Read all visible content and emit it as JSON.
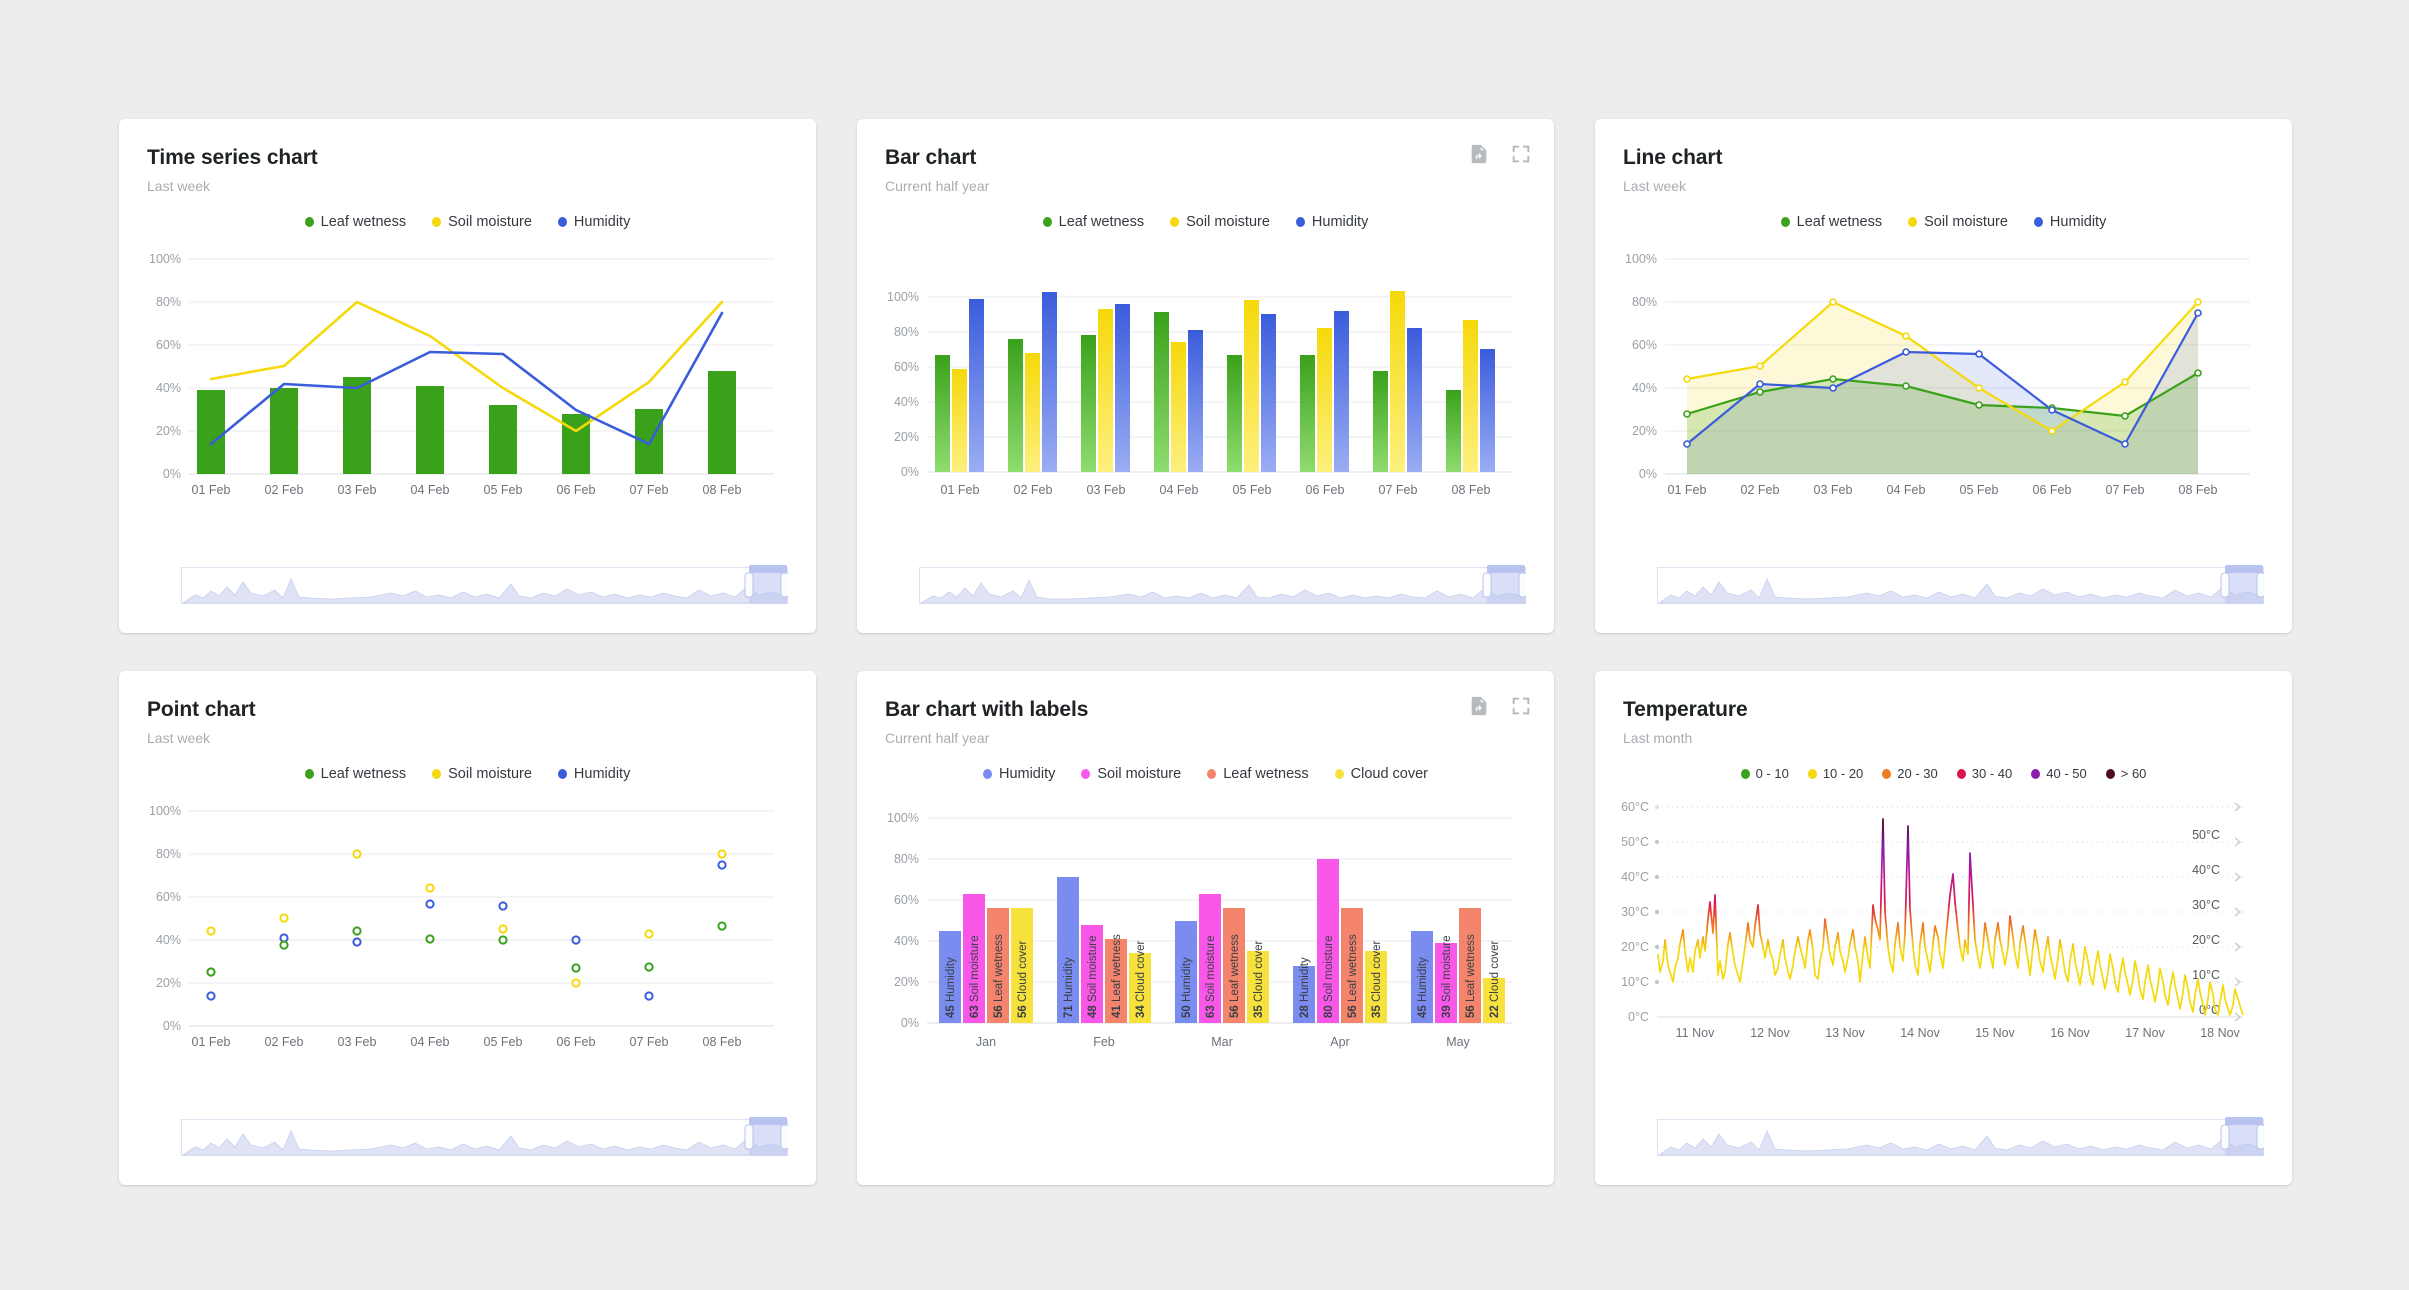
{
  "theme": {
    "page_bg": "#ebedef",
    "card_bg": "#ffffff",
    "colors": {
      "leaf_wetness": "#3aa11b",
      "soil_moisture": "#f5d90a",
      "humidity": "#3b5cdb",
      "cloud_cover": "#f7e13c",
      "soil_moisture_pink": "#f857e8",
      "leaf_wetness_salmon": "#f4846b",
      "humidity_periwinkle": "#7a8cf0"
    }
  },
  "cards": [
    {
      "id": "time-series-chart",
      "title": "Time series chart",
      "subtitle": "Last week",
      "tools": [],
      "legend": [
        {
          "label": "Leaf wetness",
          "color": "#3aa11b"
        },
        {
          "label": "Soil moisture",
          "color": "#f5d90a"
        },
        {
          "label": "Humidity",
          "color": "#3b5cdb"
        }
      ]
    },
    {
      "id": "bar-chart",
      "title": "Bar chart",
      "subtitle": "Current half year",
      "tools": [
        "export-icon",
        "fullscreen-icon"
      ],
      "legend": [
        {
          "label": "Leaf wetness",
          "color": "#3aa11b"
        },
        {
          "label": "Soil moisture",
          "color": "#f5d90a"
        },
        {
          "label": "Humidity",
          "color": "#3b5cdb"
        }
      ]
    },
    {
      "id": "line-chart",
      "title": "Line chart",
      "subtitle": "Last week",
      "tools": [],
      "legend": [
        {
          "label": "Leaf wetness",
          "color": "#3aa11b"
        },
        {
          "label": "Soil moisture",
          "color": "#f5d90a"
        },
        {
          "label": "Humidity",
          "color": "#3b5cdb"
        }
      ]
    },
    {
      "id": "point-chart",
      "title": "Point chart",
      "subtitle": "Last week",
      "tools": [],
      "legend": [
        {
          "label": "Leaf wetness",
          "color": "#3aa11b"
        },
        {
          "label": "Soil moisture",
          "color": "#f5d90a"
        },
        {
          "label": "Humidity",
          "color": "#3b5cdb"
        }
      ]
    },
    {
      "id": "bar-chart-with-labels",
      "title": "Bar chart with labels",
      "subtitle": "Current half year",
      "tools": [
        "export-icon",
        "fullscreen-icon"
      ],
      "legend": [
        {
          "label": "Humidity",
          "color": "#7a8cf0"
        },
        {
          "label": "Soil moisture",
          "color": "#f857e8"
        },
        {
          "label": "Leaf wetness",
          "color": "#f4846b"
        },
        {
          "label": "Cloud cover",
          "color": "#f7e13c"
        }
      ]
    },
    {
      "id": "temperature-chart",
      "title": "Temperature",
      "subtitle": "Last month",
      "tools": [],
      "legend": [
        {
          "label": "0 - 10",
          "color": "#3aa11b"
        },
        {
          "label": "10 - 20",
          "color": "#f5d90a"
        },
        {
          "label": "20 - 30",
          "color": "#f07c1e"
        },
        {
          "label": "30 - 40",
          "color": "#d9154a"
        },
        {
          "label": "40 - 50",
          "color": "#8c1cb0"
        },
        {
          "label": "> 60",
          "color": "#4d0b1e"
        }
      ]
    }
  ],
  "chart_data": [
    {
      "id": "time-series-chart",
      "type": "bar+line",
      "title": "Time series chart",
      "subtitle": "Last week",
      "categories": [
        "01 Feb",
        "02 Feb",
        "03 Feb",
        "04 Feb",
        "05 Feb",
        "06 Feb",
        "07 Feb",
        "08 Feb"
      ],
      "ylabel": "",
      "ytick_labels": [
        "0%",
        "20%",
        "40%",
        "60%",
        "80%",
        "100%"
      ],
      "ylim": [
        0,
        100
      ],
      "grid": true,
      "legend_position": "top-center",
      "series": [
        {
          "name": "Leaf wetness",
          "render": "bar",
          "color": "#3aa11b",
          "values": [
            39,
            40,
            45,
            41,
            32,
            28,
            30,
            48
          ]
        },
        {
          "name": "Soil moisture",
          "render": "line",
          "color": "#f5d90a",
          "values": [
            44,
            50,
            81,
            65,
            40,
            20,
            43,
            81
          ]
        },
        {
          "name": "Humidity",
          "render": "line",
          "color": "#3b5cdb",
          "values": [
            14,
            42,
            40,
            57,
            56,
            30,
            14,
            75
          ]
        }
      ]
    },
    {
      "id": "bar-chart",
      "type": "bar",
      "title": "Bar chart",
      "subtitle": "Current half year",
      "categories": [
        "01 Feb",
        "02 Feb",
        "03 Feb",
        "04 Feb",
        "05 Feb",
        "06 Feb",
        "07 Feb",
        "08 Feb"
      ],
      "ytick_labels": [
        "0%",
        "20%",
        "40%",
        "60%",
        "80%",
        "100%"
      ],
      "ylim": [
        0,
        110
      ],
      "grid": true,
      "legend_position": "top-center",
      "series": [
        {
          "name": "Leaf wetness",
          "color": "#3aa11b",
          "values": [
            67,
            76,
            78,
            91,
            67,
            67,
            58,
            47
          ]
        },
        {
          "name": "Soil moisture",
          "color": "#f5d90a",
          "values": [
            59,
            68,
            93,
            74,
            98,
            82,
            103,
            87
          ]
        },
        {
          "name": "Humidity",
          "color": "#3b5cdb",
          "values": [
            99,
            103,
            96,
            81,
            90,
            92,
            82,
            70
          ]
        }
      ]
    },
    {
      "id": "line-chart",
      "type": "area",
      "title": "Line chart",
      "subtitle": "Last week",
      "categories": [
        "01 Feb",
        "02 Feb",
        "03 Feb",
        "04 Feb",
        "05 Feb",
        "06 Feb",
        "07 Feb",
        "08 Feb"
      ],
      "ytick_labels": [
        "0%",
        "20%",
        "40%",
        "60%",
        "80%",
        "100%"
      ],
      "ylim": [
        0,
        100
      ],
      "grid": true,
      "legend_position": "top-center",
      "series": [
        {
          "name": "Leaf wetness",
          "color": "#3aa11b",
          "values": [
            28,
            38,
            44,
            41,
            32,
            31,
            27,
            47
          ]
        },
        {
          "name": "Soil moisture",
          "color": "#f5d90a",
          "values": [
            44,
            50,
            81,
            65,
            40,
            20,
            43,
            81
          ]
        },
        {
          "name": "Humidity",
          "color": "#3b5cdb",
          "values": [
            14,
            42,
            40,
            57,
            56,
            30,
            14,
            75
          ]
        }
      ]
    },
    {
      "id": "point-chart",
      "type": "scatter",
      "title": "Point chart",
      "subtitle": "Last week",
      "categories": [
        "01 Feb",
        "02 Feb",
        "03 Feb",
        "04 Feb",
        "05 Feb",
        "06 Feb",
        "07 Feb",
        "08 Feb"
      ],
      "ytick_labels": [
        "0%",
        "20%",
        "40%",
        "60%",
        "80%",
        "100%"
      ],
      "ylim": [
        0,
        100
      ],
      "grid": true,
      "legend_position": "top-center",
      "series": [
        {
          "name": "Leaf wetness",
          "color": "#3aa11b",
          "values": [
            25,
            42,
            45,
            41,
            44,
            33,
            27,
            47
          ]
        },
        {
          "name": "Soil moisture",
          "color": "#f5d90a",
          "values": [
            44,
            50,
            81,
            65,
            45,
            20,
            43,
            81
          ]
        },
        {
          "name": "Humidity",
          "color": "#3b5cdb",
          "values": [
            14,
            42,
            39,
            57,
            56,
            40,
            14,
            75
          ]
        }
      ]
    },
    {
      "id": "bar-chart-with-labels",
      "type": "bar",
      "title": "Bar chart with labels",
      "subtitle": "Current half year",
      "categories": [
        "Jan",
        "Feb",
        "Mar",
        "Apr",
        "May"
      ],
      "ytick_labels": [
        "0%",
        "20%",
        "40%",
        "60%",
        "80%",
        "100%"
      ],
      "ylim": [
        0,
        100
      ],
      "grid": true,
      "legend_position": "top-center",
      "data_labels": true,
      "series": [
        {
          "name": "Humidity",
          "color": "#7a8cf0",
          "values": [
            45,
            71,
            50,
            28,
            45
          ]
        },
        {
          "name": "Soil moisture",
          "color": "#f857e8",
          "values": [
            63,
            48,
            63,
            80,
            39
          ]
        },
        {
          "name": "Leaf wetness",
          "color": "#f4846b",
          "values": [
            56,
            41,
            56,
            56,
            56
          ]
        },
        {
          "name": "Cloud cover",
          "color": "#f7e13c",
          "values": [
            56,
            34,
            35,
            35,
            22
          ]
        }
      ]
    },
    {
      "id": "temperature-chart",
      "type": "line",
      "title": "Temperature",
      "subtitle": "Last month",
      "xlabel": "",
      "ylabel": "",
      "categories": [
        "11 Nov",
        "12 Nov",
        "13 Nov",
        "14 Nov",
        "15 Nov",
        "16 Nov",
        "17 Nov",
        "18 Nov"
      ],
      "ytick_labels": [
        "0°C",
        "10°C",
        "20°C",
        "30°C",
        "40°C",
        "50°C",
        "60°C"
      ],
      "ytick_labels_right": [
        "0°C",
        "10°C",
        "20°C",
        "30°C",
        "40°C",
        "50°C"
      ],
      "ylim": [
        0,
        60
      ],
      "grid": true,
      "grid_style": "dotted",
      "legend_position": "top-center",
      "color_bands": [
        {
          "range": "0 - 10",
          "color": "#3aa11b"
        },
        {
          "range": "10 - 20",
          "color": "#f5d90a"
        },
        {
          "range": "20 - 30",
          "color": "#f07c1e"
        },
        {
          "range": "30 - 40",
          "color": "#d9154a"
        },
        {
          "range": "40 - 50",
          "color": "#8c1cb0"
        },
        {
          "range": "> 60",
          "color": "#4d0b1e"
        }
      ],
      "series": [
        {
          "name": "Temperature",
          "values": [
            18,
            13,
            16,
            22,
            15,
            13,
            10,
            14,
            17,
            21,
            25,
            19,
            14,
            17,
            13,
            19,
            22,
            17,
            23,
            19,
            28,
            33,
            24,
            35,
            12,
            16,
            11,
            13,
            21,
            24,
            18,
            15,
            12,
            10,
            16,
            20,
            27,
            22,
            20,
            26,
            32,
            24,
            20,
            17,
            22,
            19,
            16,
            12,
            14,
            18,
            22,
            17,
            13,
            11,
            15,
            19,
            23,
            20,
            17,
            14,
            22,
            25,
            19,
            13,
            11,
            16,
            20,
            28,
            22,
            18,
            15,
            20,
            24,
            19,
            16,
            13,
            17,
            21,
            25,
            20,
            16,
            12,
            18,
            22,
            17,
            14,
            52,
            30,
            20,
            16,
            13,
            19,
            24,
            20,
            16,
            22,
            50,
            31,
            20,
            15,
            12,
            18,
            24,
            20,
            16,
            13,
            19,
            25,
            22,
            18,
            15,
            20,
            26,
            31,
            35,
            28,
            22,
            18,
            15,
            20,
            47,
            33,
            22,
            17,
            14,
            19,
            25,
            21,
            17,
            14,
            20,
            26,
            22,
            18,
            15,
            21,
            27,
            23,
            18,
            14,
            19,
            24,
            20,
            16,
            13,
            18,
            22,
            18,
            15,
            12,
            17,
            21,
            18,
            14,
            11,
            16,
            20,
            17,
            13,
            10,
            15,
            19,
            16,
            12,
            18,
            22,
            18,
            14,
            11,
            16,
            20,
            17,
            13,
            19,
            23,
            19,
            15,
            12,
            17,
            21,
            18,
            14,
            11,
            16,
            20,
            17,
            13,
            10,
            15,
            19,
            16,
            12,
            9,
            14,
            18,
            15,
            11,
            16,
            20,
            17,
            13,
            10,
            15,
            19,
            16,
            12,
            9,
            14,
            18,
            15,
            11,
            8,
            13,
            17,
            14,
            10,
            15,
            19,
            16,
            12,
            9,
            14,
            18,
            15,
            11,
            8,
            13,
            17,
            14,
            10,
            7,
            12,
            16,
            13,
            9,
            14,
            18,
            15,
            11,
            8,
            13
          ]
        }
      ]
    }
  ]
}
